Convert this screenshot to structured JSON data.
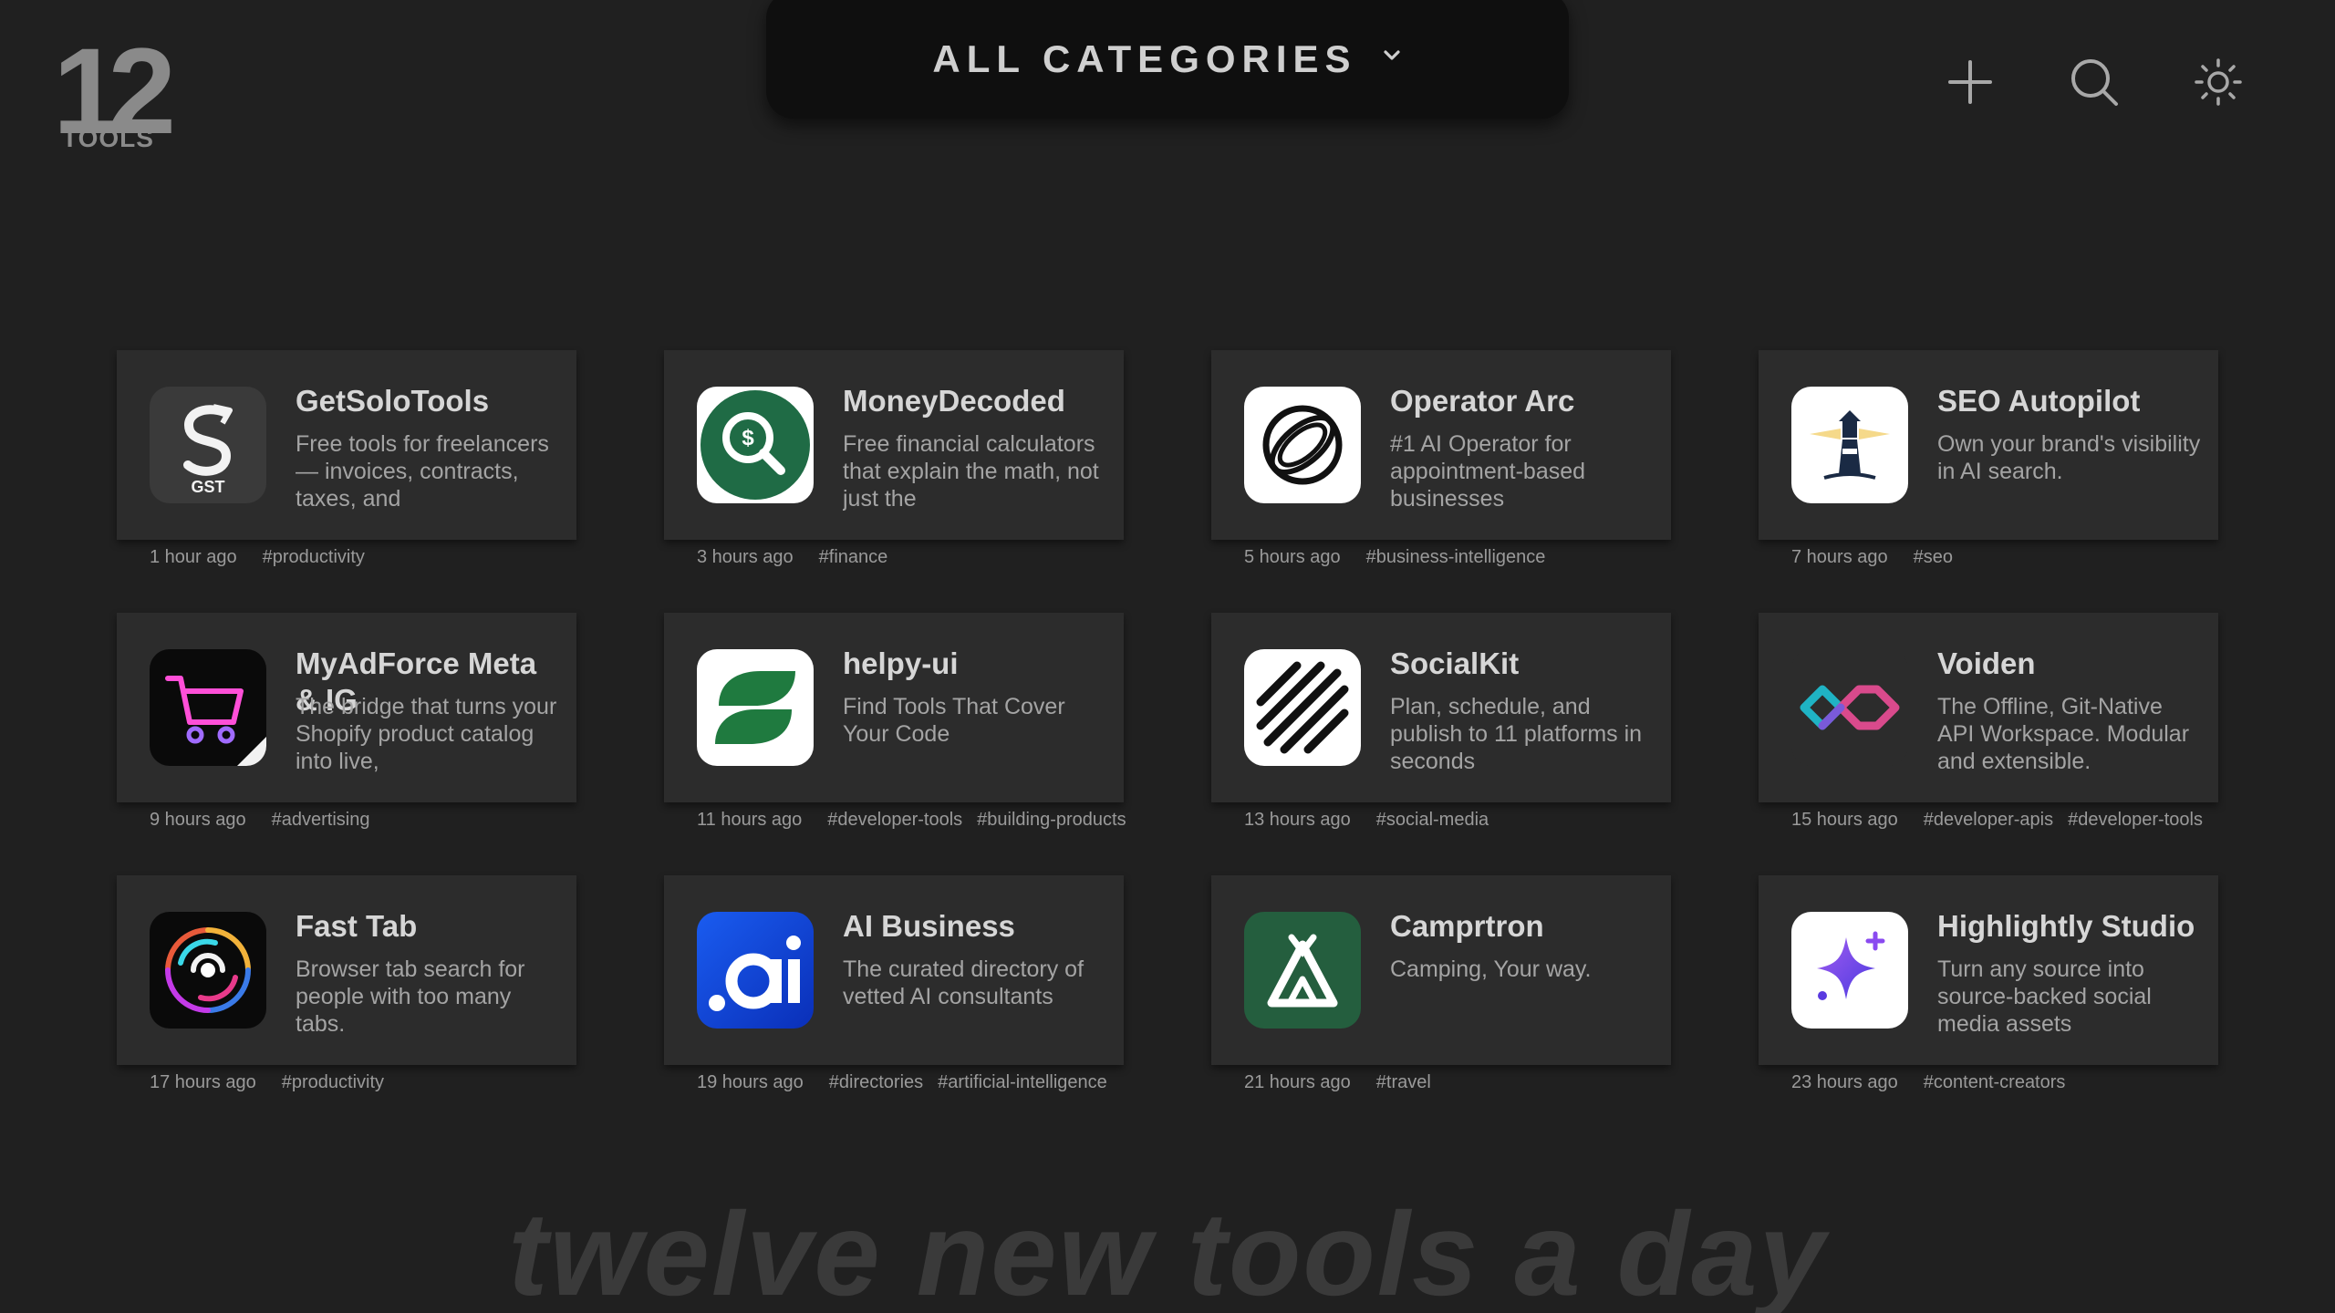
{
  "logo": {
    "number": "12",
    "word": "TOOLS"
  },
  "header": {
    "category_label": "ALL CATEGORIES",
    "chevron_icon": "chevron-down-icon",
    "actions": [
      {
        "name": "add-button",
        "icon": "plus-icon"
      },
      {
        "name": "search-button",
        "icon": "search-icon"
      },
      {
        "name": "theme-toggle-button",
        "icon": "sun-icon"
      }
    ]
  },
  "tools": [
    {
      "title": "GetSoloTools",
      "desc": "Free tools for freelancers — invoices, contracts, taxes, and",
      "time": "1 hour ago",
      "tags": [
        "#productivity"
      ],
      "icon": "gst-icon"
    },
    {
      "title": "MoneyDecoded",
      "desc": "Free financial calculators that explain the math, not just the",
      "time": "3 hours ago",
      "tags": [
        "#finance"
      ],
      "icon": "money-search-icon"
    },
    {
      "title": "Operator Arc",
      "desc": "#1 AI Operator for appointment-based businesses",
      "time": "5 hours ago",
      "tags": [
        "#business-intelligence"
      ],
      "icon": "orbit-icon"
    },
    {
      "title": "SEO Autopilot",
      "desc": "Own your brand's visibility in AI search.",
      "time": "7 hours ago",
      "tags": [
        "#seo"
      ],
      "icon": "lighthouse-icon"
    },
    {
      "title": "MyAdForce Meta & IG",
      "desc": "The bridge that turns your Shopify product catalog into live,",
      "time": "9 hours ago",
      "tags": [
        "#advertising"
      ],
      "icon": "cart-icon"
    },
    {
      "title": "helpy-ui",
      "desc": "Find Tools That Cover Your Code",
      "time": "11 hours ago",
      "tags": [
        "#developer-tools",
        "#building-products"
      ],
      "icon": "leaf-icon"
    },
    {
      "title": "SocialKit",
      "desc": "Plan, schedule, and publish to 11 platforms in seconds",
      "time": "13 hours ago",
      "tags": [
        "#social-media"
      ],
      "icon": "stripes-icon"
    },
    {
      "title": "Voiden",
      "desc": "The Offline, Git-Native API Workspace. Modular and extensible.",
      "time": "15 hours ago",
      "tags": [
        "#developer-apis",
        "#developer-tools"
      ],
      "icon": "infinity-icon"
    },
    {
      "title": "Fast Tab",
      "desc": "Browser tab search for people with too many tabs.",
      "time": "17 hours ago",
      "tags": [
        "#productivity"
      ],
      "icon": "swirl-icon"
    },
    {
      "title": "AI Business",
      "desc": "The curated directory of vetted AI consultants",
      "time": "19 hours ago",
      "tags": [
        "#directories",
        "#artificial-intelligence"
      ],
      "icon": "ai-logo-icon"
    },
    {
      "title": "Camprtron",
      "desc": "Camping, Your way.",
      "time": "21 hours ago",
      "tags": [
        "#travel"
      ],
      "icon": "tent-icon"
    },
    {
      "title": "Highlightly Studio",
      "desc": "Turn any source into source-backed social media assets",
      "time": "23 hours ago",
      "tags": [
        "#content-creators"
      ],
      "icon": "sparkle-icon"
    }
  ],
  "footer": {
    "tagline": "twelve new tools a day"
  }
}
